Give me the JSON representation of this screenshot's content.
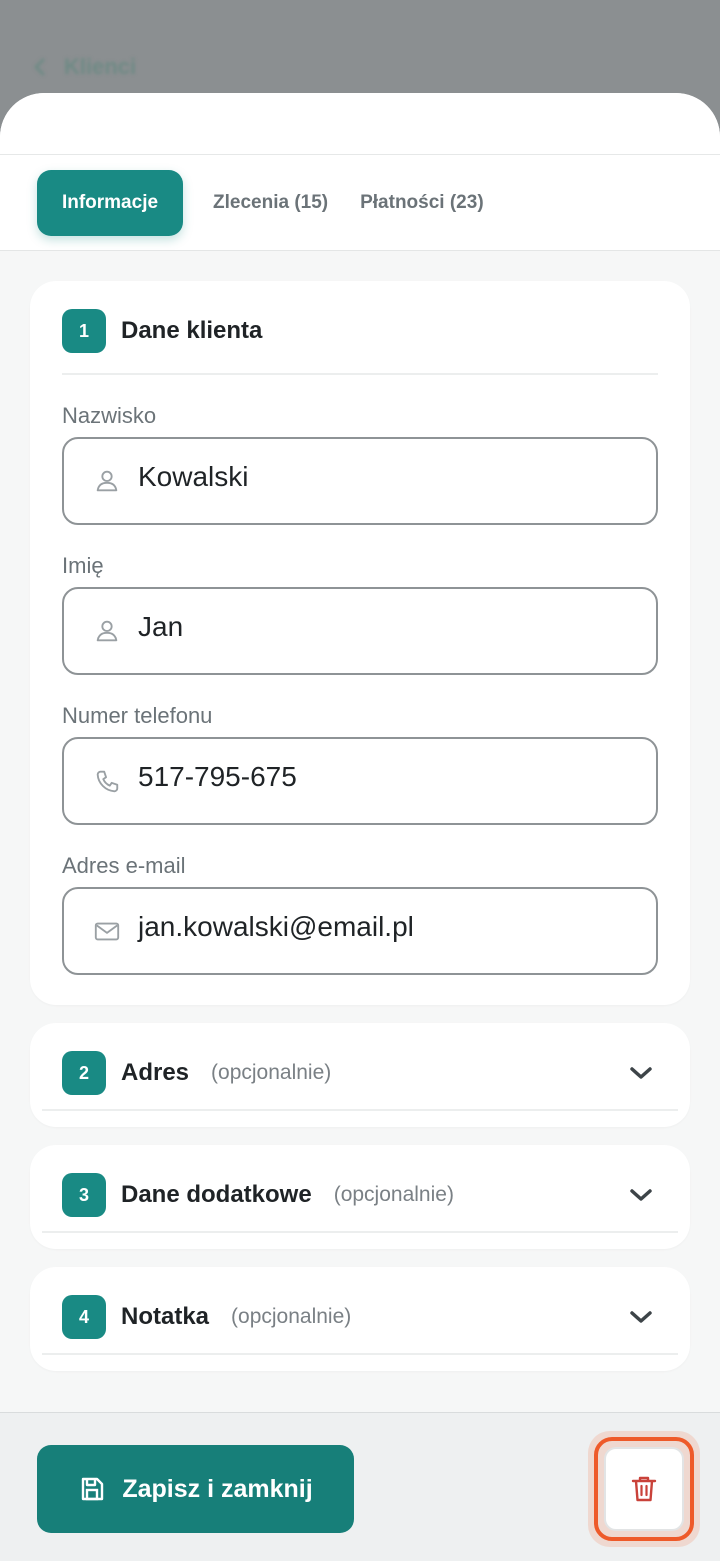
{
  "background": {
    "back_label": "Klienci"
  },
  "sheet": {
    "stray_glyph": ">"
  },
  "tabs": [
    {
      "label": "Informacje",
      "active": true
    },
    {
      "label": "Zlecenia (15)",
      "active": false
    },
    {
      "label": "Płatności (23)",
      "active": false
    }
  ],
  "section1": {
    "number": "1",
    "title": "Dane klienta",
    "fields": [
      {
        "label": "Nazwisko",
        "value": "Kowalski",
        "icon": "user-icon"
      },
      {
        "label": "Imię",
        "value": "Jan",
        "icon": "user-icon"
      },
      {
        "label": "Numer telefonu",
        "value": "517-795-675",
        "icon": "phone-icon"
      },
      {
        "label": "Adres e-mail",
        "value": "jan.kowalski@email.pl",
        "icon": "mail-icon"
      }
    ]
  },
  "section2": {
    "number": "2",
    "title": "Adres",
    "optional": "(opcjonalnie)"
  },
  "section3": {
    "number": "3",
    "title": "Dane dodatkowe",
    "optional": "(opcjonalnie)"
  },
  "section4": {
    "number": "4",
    "title": "Notatka",
    "optional": "(opcjonalnie)"
  },
  "footer": {
    "save_label": "Zapisz i zamknij",
    "delete_icon": "trash-icon"
  },
  "colors": {
    "accent": "#198a84",
    "delete_highlight": "#ee5a2a",
    "delete_icon": "#c9423a"
  }
}
